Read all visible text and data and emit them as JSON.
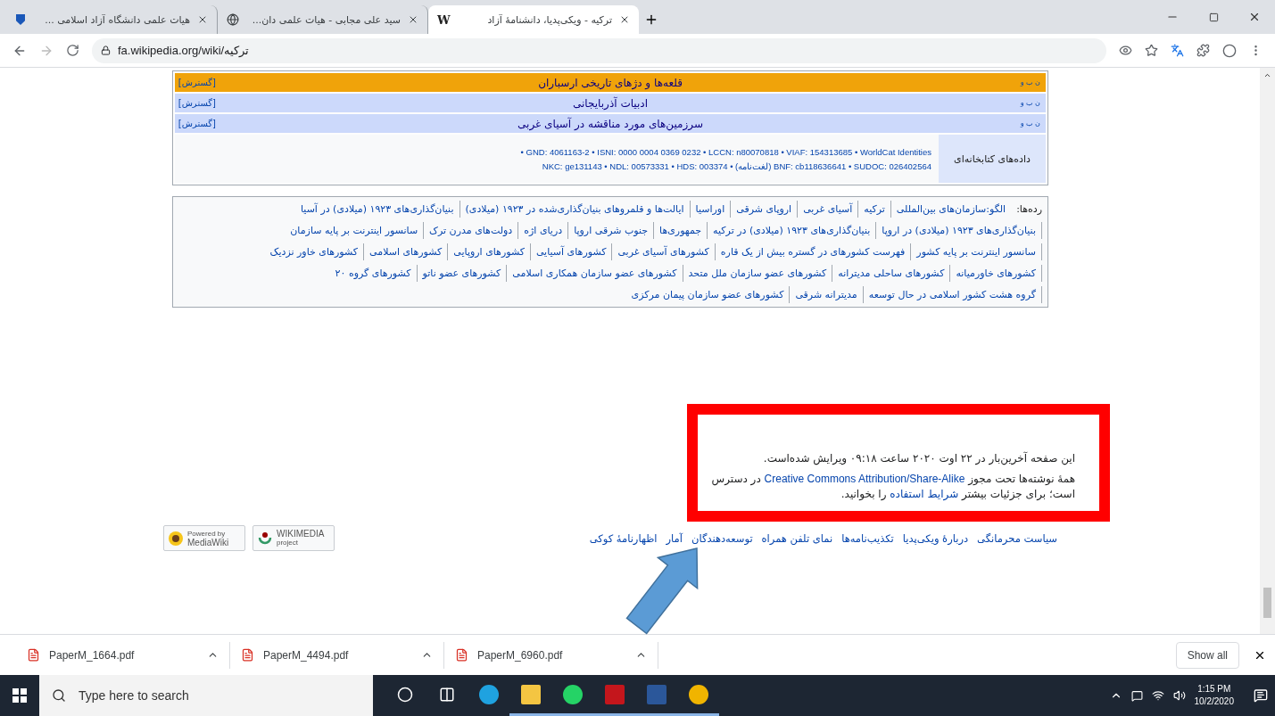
{
  "browser": {
    "tabs": [
      {
        "title": "ترکیه - ویکی‌پدیا، دانشنامهٔ آزاد",
        "kind": "letter",
        "icon_text": "W",
        "selected": true
      },
      {
        "title": "سید علی مجابی - هیات علمی دان...",
        "kind": "globe",
        "selected": false
      },
      {
        "title": "هیات علمی دانشگاه آزاد اسلامی ...",
        "kind": "shield",
        "selected": false
      }
    ],
    "url": "fa.wikipedia.org/wiki/ترکیه"
  },
  "navboxes": [
    {
      "title": "قلعه‌ها و دژهای تاریخی ارسباران",
      "toggle": "[گسترش]",
      "links": "ن ب و",
      "highlighted": true
    },
    {
      "title": "ادبیات آذربایجانی",
      "toggle": "[گسترش]",
      "links": "ن ب و",
      "highlighted": false
    },
    {
      "title": "سرزمین‌های مورد مناقشه در آسیای غربی",
      "toggle": "[گسترش]",
      "links": "ن ب و",
      "highlighted": false
    }
  ],
  "authority": {
    "label": "داده‌های کتابخانه‌ای",
    "lines": [
      "• GND: 4061163-2 • ISNI: 0000 0004 0369 0232 • LCCN: n80070818 • VIAF: 154313685 • WorldCat Identities",
      "NKC: ge131143 • NDL: 00573331 • HDS: 003374 • (لغت‌نامه) BNF: cb118636641 • SUDOC: 026402564"
    ]
  },
  "categories": {
    "label": "رده‌ها:",
    "items": [
      "الگو:سازمان‌های بین‌المللی",
      "ترکیه",
      "آسیای غربی",
      "اروپای شرقی",
      "اوراسیا",
      "ایالت‌ها و قلمروهای بنیان‌گذاری‌شده در ۱۹۲۳ (میلادی)",
      "بنیان‌گذاری‌های ۱۹۲۳ (میلادی) در آسیا",
      "بنیان‌گذاری‌های ۱۹۲۳ (میلادی) در اروپا",
      "بنیان‌گذاری‌های ۱۹۲۳ (میلادی) در ترکیه",
      "جمهوری‌ها",
      "جنوب شرقی اروپا",
      "دریای اژه",
      "دولت‌های مدرن ترک",
      "سانسور اینترنت بر پایه سازمان",
      "سانسور اینترنت بر پایه کشور",
      "فهرست کشورهای در گستره بیش از یک قاره",
      "کشورهای آسیای غربی",
      "کشورهای آسیایی",
      "کشورهای اروپایی",
      "کشورهای اسلامی",
      "کشورهای خاور نزدیک",
      "کشورهای خاورمیانه",
      "کشورهای ساحلی مدیترانه",
      "کشورهای عضو سازمان ملل متحد",
      "کشورهای عضو سازمان همکاری اسلامی",
      "کشورهای عضو ناتو",
      "کشورهای گروه ۲۰",
      "گروه هشت کشور اسلامی در حال توسعه",
      "مدیترانه شرقی",
      "کشورهای عضو سازمان پیمان مرکزی"
    ]
  },
  "footer": {
    "last_edit": "این صفحه آخرین‌بار در ۲۲ اوت ۲۰۲۰ ساعت ۰۹:۱۸ ویرایش شده‌است.",
    "license_before": "همهٔ نوشته‌ها تحت مجوز",
    "license_link": "Creative Commons Attribution/Share-Alike",
    "license_middle": "در دسترس است؛ برای جزئیات بیشتر",
    "terms_link": "شرایط استفاده",
    "license_end": "را بخوانید.",
    "links": [
      "سیاست محرمانگی",
      "دربارهٔ ویکی‌پدیا",
      "تکذیب‌نامه‌ها",
      "نمای تلفن همراه",
      "توسعه‌دهندگان",
      "آمار",
      "اظهارنامهٔ کوکی"
    ],
    "badges": [
      {
        "kind": "wikimedia",
        "lines": [
          "WIKIMEDIA",
          "project"
        ]
      },
      {
        "kind": "mediawiki",
        "lines": [
          "Powered by",
          "MediaWiki"
        ]
      }
    ]
  },
  "downloads": {
    "files": [
      "PaperM_6960.pdf",
      "PaperM_4494.pdf",
      "PaperM_1664.pdf"
    ],
    "show_all": "Show all"
  },
  "taskbar": {
    "search_placeholder": "Type here to search",
    "apps": [
      {
        "kind": "cortana",
        "active": false
      },
      {
        "kind": "taskview",
        "active": false
      },
      {
        "kind": "edge",
        "active": false
      },
      {
        "kind": "explorer",
        "active": true
      },
      {
        "kind": "whatsapp",
        "active": true
      },
      {
        "kind": "acrobat",
        "active": true
      },
      {
        "kind": "word",
        "active": true
      },
      {
        "kind": "chrome",
        "active": true
      }
    ],
    "time": "1:15 PM",
    "date": "10/2/2020"
  }
}
